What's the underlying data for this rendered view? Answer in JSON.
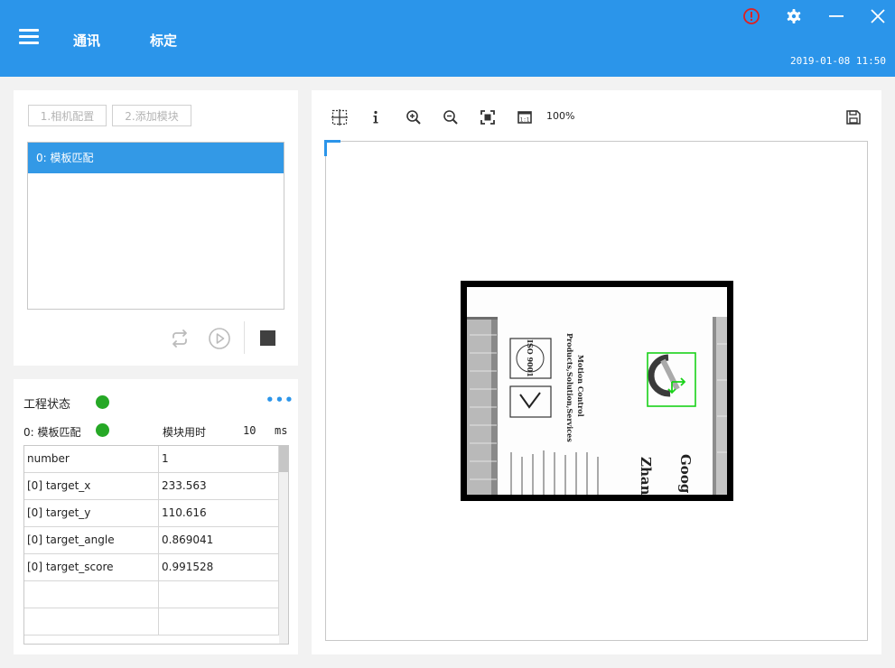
{
  "header": {
    "tabs": [
      "通讯",
      "标定"
    ],
    "datetime": "2019-01-08 11:50"
  },
  "flow": {
    "buttons": [
      "1.相机配置",
      "2.添加模块"
    ],
    "modules": [
      "0: 模板匹配"
    ]
  },
  "status": {
    "title": "工程状态",
    "status_color": "#26a826",
    "module": "0: 模板匹配",
    "module_time_label": "模块用时",
    "module_time_value": "10",
    "module_time_unit": "ms",
    "rows": [
      {
        "key": "number",
        "value": "1"
      },
      {
        "key": "[0] target_x",
        "value": "233.563"
      },
      {
        "key": "[0] target_y",
        "value": "110.616"
      },
      {
        "key": "[0] target_angle",
        "value": "0.869041"
      },
      {
        "key": "[0] target_score",
        "value": "0.991528"
      },
      {
        "key": "",
        "value": ""
      },
      {
        "key": "",
        "value": ""
      }
    ]
  },
  "viewer": {
    "zoom": "100%",
    "match_box_color": "#19d219"
  },
  "image_text": {
    "line1": "Motion Control",
    "line2": "Products,Solution,Services",
    "line3": "Goog",
    "line4": "Zhan",
    "iso": "ISO 9001"
  },
  "colors": {
    "accent": "#2b95ea",
    "alert": "#e02020"
  }
}
